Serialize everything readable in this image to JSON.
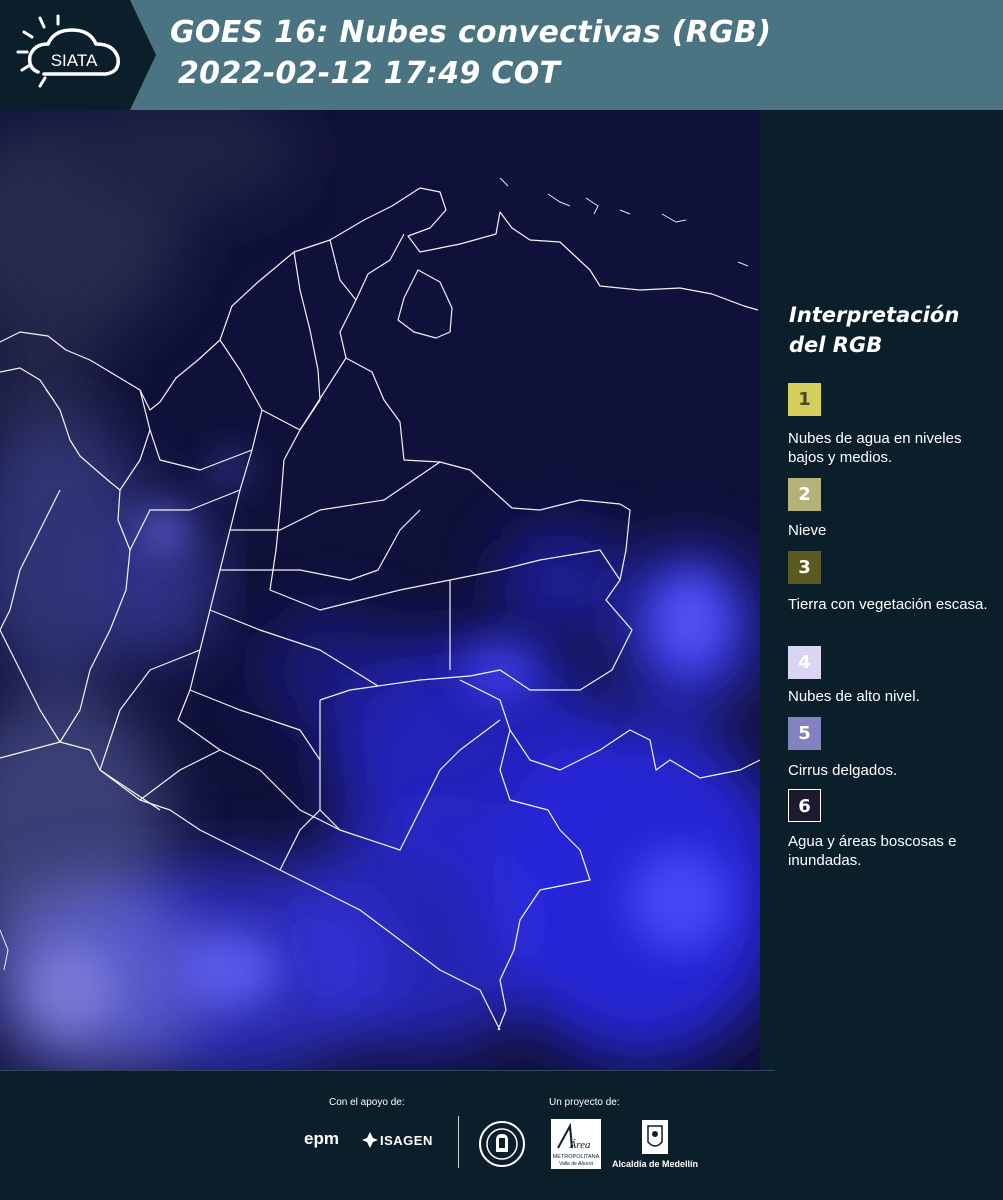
{
  "header": {
    "logo_text": "SIATA",
    "title_line1": "GOES 16: Nubes convectivas (RGB)",
    "title_line2": "2022-02-12 17:49 COT"
  },
  "map": {
    "background": "#10113a",
    "border_color": "#ffffff"
  },
  "legend": {
    "title": "Interpretación del RGB",
    "items": [
      {
        "number": "1",
        "label": "Nubes de agua en niveles bajos y medios.",
        "color": "#d3cf5a",
        "text_color": "#4a4a2a"
      },
      {
        "number": "2",
        "label": "Nieve",
        "color": "#b4b17a",
        "text_color": "#ffffff"
      },
      {
        "number": "3",
        "label": "Tierra con vegetación escasa.",
        "color": "#5b5a22",
        "text_color": "#ffffff"
      },
      {
        "number": "4",
        "label": "Nubes de alto nivel.",
        "color": "#d8d6f3",
        "text_color": "#ffffff"
      },
      {
        "number": "5",
        "label": "Cirrus delgados.",
        "color": "#8382c0",
        "text_color": "#ffffff"
      },
      {
        "number": "6",
        "label": "Agua y áreas boscosas e inundadas.",
        "color": "#1b1a2e",
        "text_color": "#ffffff"
      }
    ]
  },
  "footer": {
    "support_label": "Con el apoyo de:",
    "project_label": "Un proyecto de:",
    "sponsors": [
      "epm",
      "ISAGEN"
    ],
    "partners": [
      "Medellín",
      "Área Metropolitana Valle de Aburrá",
      "Alcaldía de Medellín"
    ],
    "alcaldia_text": "Alcaldía de Medellín",
    "area_line1": "Área",
    "area_line2": "METROPOLITANA",
    "area_line3": "Valle de Aburrá"
  }
}
